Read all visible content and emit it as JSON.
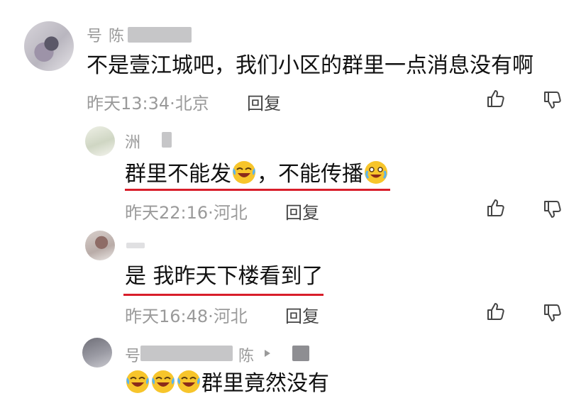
{
  "comments": [
    {
      "username": "号 陈 陈",
      "text": "不是壹江城吧，我们小区的群里一点消息没有啊",
      "time": "昨天13:34",
      "location": "北京",
      "reply_label": "回复"
    },
    {
      "username": "洲",
      "text_part1": "群里不能发",
      "text_part2": "，不能传播",
      "time": "昨天22:16",
      "location": "河北",
      "reply_label": "回复"
    },
    {
      "username": "",
      "text": "是 我昨天下楼看到了",
      "time": "昨天16:48",
      "location": "河北",
      "reply_label": "回复"
    },
    {
      "username_part1": "号",
      "username_part2": "陈",
      "text": "群里竟然没有"
    }
  ],
  "meta_separator": "·",
  "colors": {
    "underline": "#d81e2a",
    "meta": "#9a9a9a",
    "text": "#111111"
  }
}
